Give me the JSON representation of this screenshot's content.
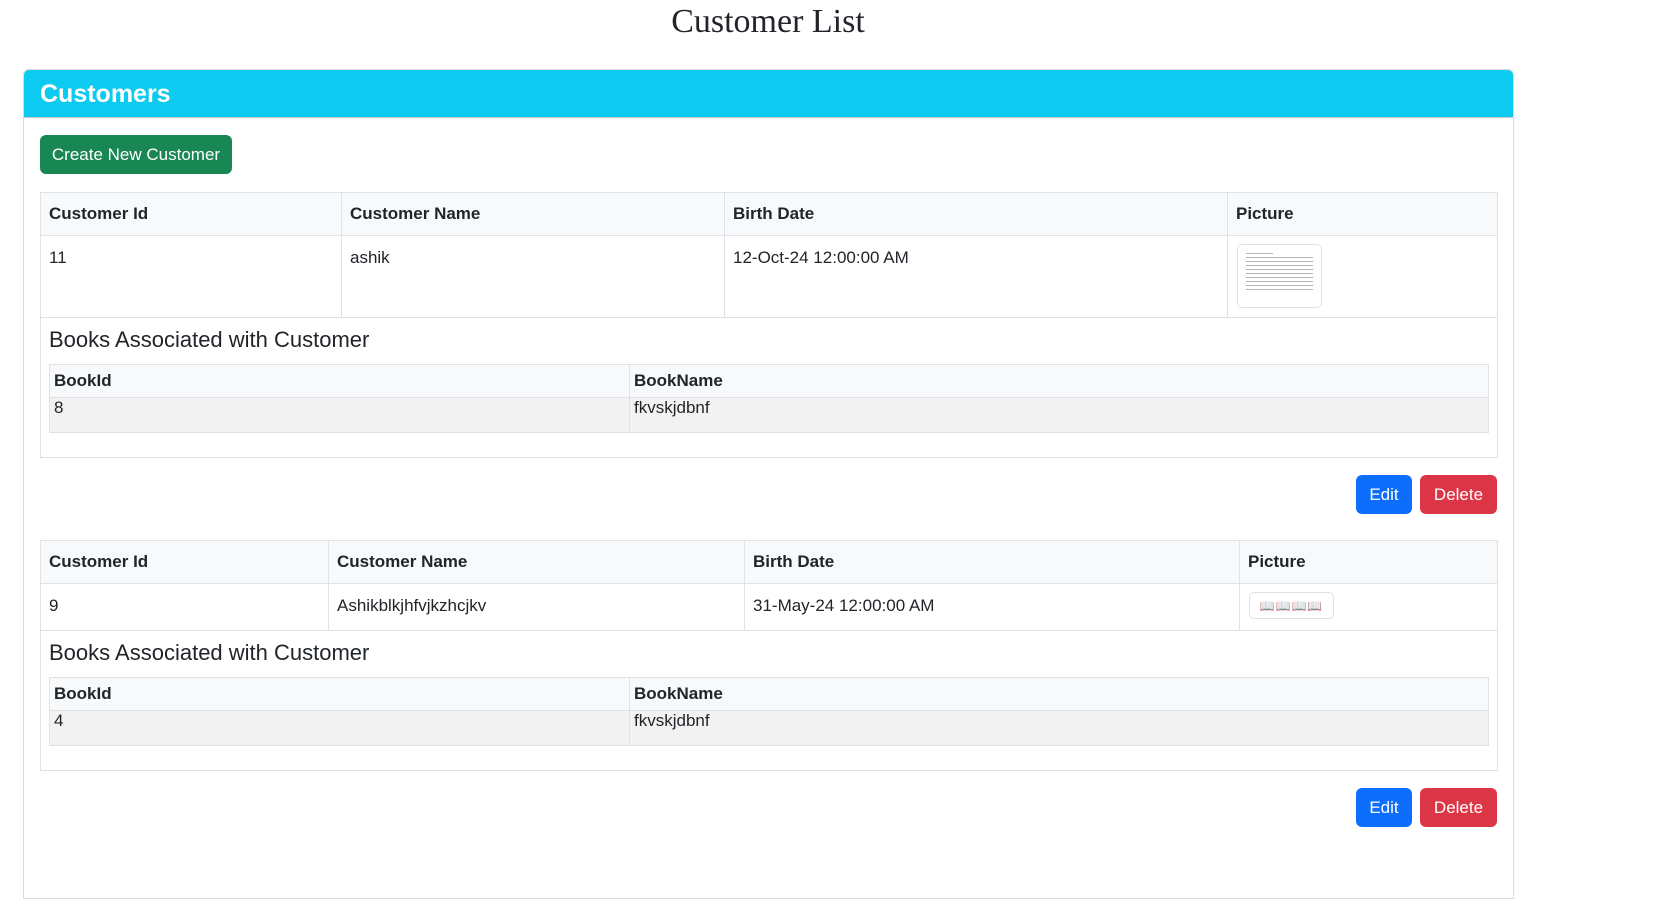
{
  "page_title": "Customer List",
  "card": {
    "header": "Customers",
    "create_button": "Create New Customer"
  },
  "table_headers": {
    "customer_id": "Customer Id",
    "customer_name": "Customer Name",
    "birth_date": "Birth Date",
    "picture": "Picture"
  },
  "books_section": {
    "title": "Books Associated with Customer",
    "col_book_id": "BookId",
    "col_book_name": "BookName"
  },
  "actions": {
    "edit_label": "Edit",
    "delete_label": "Delete"
  },
  "customers": [
    {
      "id": "11",
      "name": "ashik",
      "birth_date": "12-Oct-24 12:00:00 AM",
      "picture_icon": "document-thumbnail-icon",
      "books": [
        {
          "book_id": "8",
          "book_name": "fkvskjdbnf"
        }
      ]
    },
    {
      "id": "9",
      "name": "Ashikblkjhfvjkzhcjkv",
      "birth_date": "31-May-24 12:00:00 AM",
      "picture_icon": "books-thumbnail-icon",
      "picture_glyphs": "📖📖📖📖",
      "books": [
        {
          "book_id": "4",
          "book_name": "fkvskjdbnf"
        }
      ]
    }
  ],
  "colors": {
    "header_bg": "#0dcaf0",
    "success": "#198754",
    "primary": "#0d6efd",
    "danger": "#dc3545"
  }
}
